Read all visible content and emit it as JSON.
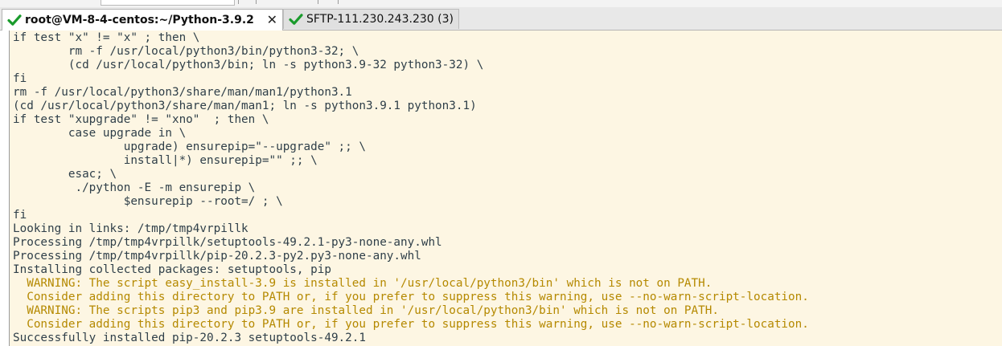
{
  "colors": {
    "terminal_bg": "#fdf6e3",
    "terminal_fg": "#2f3f49",
    "warning_fg": "#b58900",
    "check_green": "#1a9b2c"
  },
  "tabs": [
    {
      "label": "root@VM-8-4-centos:~/Python-3.9.2",
      "icon": "check-icon",
      "close": "✕",
      "active": true
    },
    {
      "label": "SFTP-111.230.243.230 (3)",
      "icon": "check-icon",
      "active": false
    }
  ],
  "terminal": {
    "lines": [
      {
        "text": "if test \"x\" != \"x\" ; then \\",
        "type": "normal"
      },
      {
        "text": "        rm -f /usr/local/python3/bin/python3-32; \\",
        "type": "normal"
      },
      {
        "text": "        (cd /usr/local/python3/bin; ln -s python3.9-32 python3-32) \\",
        "type": "normal"
      },
      {
        "text": "fi",
        "type": "normal"
      },
      {
        "text": "rm -f /usr/local/python3/share/man/man1/python3.1",
        "type": "normal"
      },
      {
        "text": "(cd /usr/local/python3/share/man/man1; ln -s python3.9.1 python3.1)",
        "type": "normal"
      },
      {
        "text": "if test \"xupgrade\" != \"xno\"  ; then \\",
        "type": "normal"
      },
      {
        "text": "        case upgrade in \\",
        "type": "normal"
      },
      {
        "text": "                upgrade) ensurepip=\"--upgrade\" ;; \\",
        "type": "normal"
      },
      {
        "text": "                install|*) ensurepip=\"\" ;; \\",
        "type": "normal"
      },
      {
        "text": "        esac; \\",
        "type": "normal"
      },
      {
        "text": "         ./python -E -m ensurepip \\",
        "type": "normal"
      },
      {
        "text": "                $ensurepip --root=/ ; \\",
        "type": "normal"
      },
      {
        "text": "fi",
        "type": "normal"
      },
      {
        "text": "Looking in links: /tmp/tmp4vrpillk",
        "type": "normal"
      },
      {
        "text": "Processing /tmp/tmp4vrpillk/setuptools-49.2.1-py3-none-any.whl",
        "type": "normal"
      },
      {
        "text": "Processing /tmp/tmp4vrpillk/pip-20.2.3-py2.py3-none-any.whl",
        "type": "normal"
      },
      {
        "text": "Installing collected packages: setuptools, pip",
        "type": "normal"
      },
      {
        "text": "  WARNING: The script easy_install-3.9 is installed in '/usr/local/python3/bin' which is not on PATH.",
        "type": "warn"
      },
      {
        "text": "  Consider adding this directory to PATH or, if you prefer to suppress this warning, use --no-warn-script-location.",
        "type": "warn"
      },
      {
        "text": "  WARNING: The scripts pip3 and pip3.9 are installed in '/usr/local/python3/bin' which is not on PATH.",
        "type": "warn"
      },
      {
        "text": "  Consider adding this directory to PATH or, if you prefer to suppress this warning, use --no-warn-script-location.",
        "type": "warn"
      },
      {
        "text": "Successfully installed pip-20.2.3 setuptools-49.2.1",
        "type": "normal"
      }
    ]
  }
}
